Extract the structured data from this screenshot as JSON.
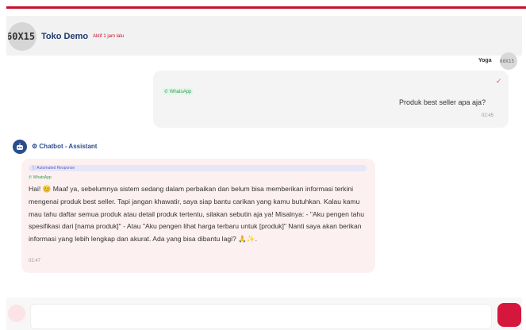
{
  "header": {
    "avatar_text": "60X15",
    "shop_name": "Toko Demo",
    "status": "Aktif 1 jam lalu"
  },
  "user": {
    "name": "Yoga",
    "avatar_text": "60X15"
  },
  "user_message": {
    "channel": "WhatsApp",
    "text": "Produk best seller apa aja?",
    "time": "02:45",
    "status_icon": "check-icon"
  },
  "bot": {
    "name": "Chatbot - Assistant",
    "badge": "Automated Response",
    "channel": "WhatsApp",
    "text": "Hai! 😊 Maaf ya, sebelumnya sistem sedang dalam perbaikan dan belum bisa memberikan informasi terkini mengenai produk best seller. Tapi jangan khawatir, saya siap bantu carikan yang kamu butuhkan. Kalau kamu mau tahu daftar semua produk atau detail produk tertentu, silakan sebutin aja ya! Misalnya: - \"Aku pengen tahu spesifikasi dari [nama produk]\" - Atau \"Aku pengen lihat harga terbaru untuk [produk]\" Nanti saya akan berikan informasi yang lebih lengkap dan akurat. Ada yang bisa dibantu lagi? 🙏✨.",
    "time": "02:47"
  },
  "colors": {
    "accent": "#c8102e",
    "bot_bubble": "#fdf0f0",
    "user_bubble": "#f4f4f4"
  }
}
